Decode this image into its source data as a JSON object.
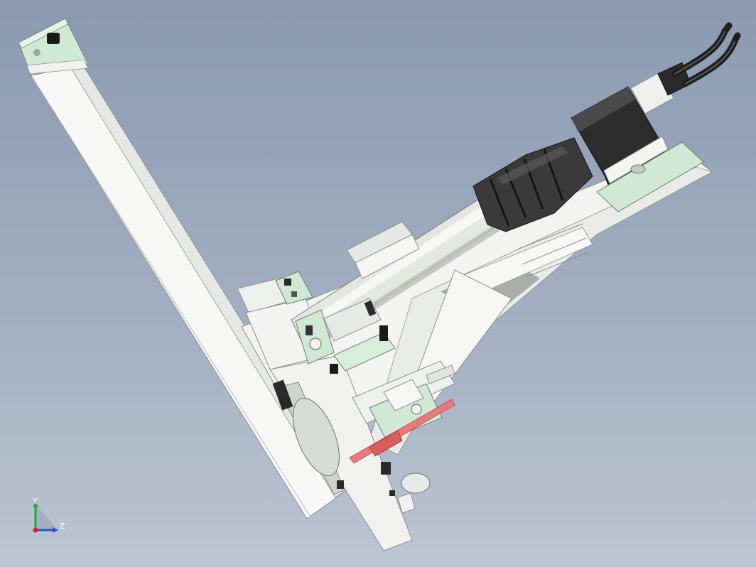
{
  "triad": {
    "y_label": "Y",
    "z_label": "Z"
  },
  "colors": {
    "background_top": "#8a9ab0",
    "background_bottom": "#bcc5d3",
    "part_white": "#f4f5f3",
    "part_edge": "#8c8f8c",
    "part_green": "#cfe9d4",
    "motor_dark": "#2a2a2a",
    "cable_dark": "#1e1e1e",
    "pin_red": "#e86a6a",
    "axis_y": "#1fa83a",
    "axis_z": "#2a4fd8",
    "axis_origin": "#d62020"
  }
}
